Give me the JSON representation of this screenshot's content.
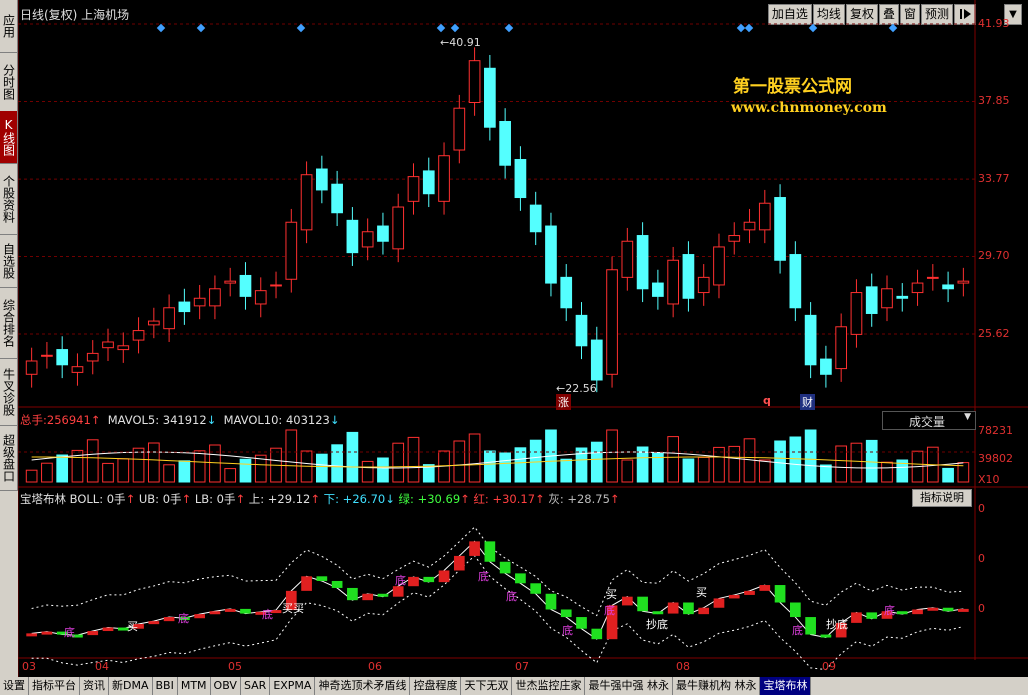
{
  "left_tabs": [
    {
      "label": "应用",
      "active": false
    },
    {
      "label": "分时图",
      "active": false
    },
    {
      "label": "K线图",
      "active": true
    },
    {
      "label": "个股资料",
      "active": false
    },
    {
      "label": "自选股",
      "active": false
    },
    {
      "label": "综合排名",
      "active": false
    },
    {
      "label": "牛叉诊股",
      "active": false
    },
    {
      "label": "超级盘口",
      "active": false
    }
  ],
  "header": {
    "title": "日线(复权) 上海机场"
  },
  "toolbar": {
    "items": [
      "加自选",
      "均线",
      "复权",
      "叠",
      "窗",
      "预测"
    ],
    "end_icon": "play-arrow-icon",
    "dropdown": "▼"
  },
  "watermark": {
    "line1": "第一股票公式网",
    "line2": "www.chnmoney.com"
  },
  "price_axis": [
    "41.93",
    "37.85",
    "33.77",
    "29.70",
    "25.62"
  ],
  "annotations": {
    "high": "40.91",
    "low": "22.56",
    "zhang": "涨",
    "q": "q",
    "cai": "财"
  },
  "volume": {
    "label_total": "总手:",
    "total": "256941",
    "ma5_label": "MAVOL5:",
    "ma5": "341912",
    "ma10_label": "MAVOL10:",
    "ma10": "403123",
    "dropdown": "成交量",
    "axis": [
      "78231",
      "39802",
      "X10"
    ]
  },
  "indicator": {
    "name": "宝塔布林",
    "boll": "BOLL: 0手",
    "ub": "UB: 0手",
    "lb": "LB: 0手",
    "up": "上: +29.12",
    "down": "下: +26.70",
    "green": "绿: +30.69",
    "red": "红: +30.17",
    "gray": "灰: +28.75",
    "help_button": "指标说明",
    "axis": [
      "0",
      "0",
      "0"
    ],
    "labels": [
      {
        "text": "底",
        "color": "#e040e0"
      },
      {
        "text": "买",
        "color": "#ffffff"
      },
      {
        "text": "底",
        "color": "#e040e0"
      },
      {
        "text": "底",
        "color": "#e040e0"
      },
      {
        "text": "买买",
        "color": "#ffffff"
      },
      {
        "text": "底",
        "color": "#e040e0"
      },
      {
        "text": "底",
        "color": "#e040e0"
      },
      {
        "text": "底",
        "color": "#e040e0"
      },
      {
        "text": "底",
        "color": "#e040e0"
      },
      {
        "text": "买",
        "color": "#ffffff"
      },
      {
        "text": "底",
        "color": "#e040e0"
      },
      {
        "text": "抄底",
        "color": "#ffffff"
      },
      {
        "text": "买",
        "color": "#ffffff"
      },
      {
        "text": "底",
        "color": "#e040e0"
      },
      {
        "text": "抄底",
        "color": "#ffffff"
      },
      {
        "text": "底",
        "color": "#e040e0"
      }
    ]
  },
  "months": [
    "03",
    "04",
    "05",
    "06",
    "07",
    "08",
    "09"
  ],
  "bottom_tabs": [
    {
      "label": "设置",
      "active": false
    },
    {
      "label": "指标平台",
      "active": false
    },
    {
      "label": "资讯",
      "active": false
    },
    {
      "label": "新DMA",
      "active": false
    },
    {
      "label": "BBI",
      "active": false
    },
    {
      "label": "MTM",
      "active": false
    },
    {
      "label": "OBV",
      "active": false
    },
    {
      "label": "SAR",
      "active": false
    },
    {
      "label": "EXPMA",
      "active": false
    },
    {
      "label": "神奇选顶术矛盾线",
      "active": false
    },
    {
      "label": "控盘程度",
      "active": false
    },
    {
      "label": "天下无双",
      "active": false
    },
    {
      "label": "世杰监控庄家",
      "active": false
    },
    {
      "label": "最牛强中强 林永",
      "active": false
    },
    {
      "label": "最牛赚机构 林永",
      "active": false
    },
    {
      "label": "宝塔布林",
      "active": true
    }
  ],
  "colors": {
    "up": "#ff3030",
    "down": "#54ffff",
    "axis": "#800000",
    "accent": "#000080"
  },
  "chart_data": {
    "type": "candlestick",
    "title": "日线(复权) 上海机场",
    "x_ticks": [
      "03",
      "04",
      "05",
      "06",
      "07",
      "08",
      "09"
    ],
    "y_ticks": [
      41.93,
      37.85,
      33.77,
      29.7,
      25.62
    ],
    "high": 40.91,
    "low": 22.56,
    "close_approx": [
      24.2,
      24.5,
      24.0,
      23.9,
      24.6,
      25.2,
      25.0,
      25.8,
      26.3,
      27.0,
      26.8,
      27.5,
      28.0,
      28.4,
      27.6,
      27.9,
      28.2,
      31.5,
      34.0,
      33.2,
      32.0,
      29.9,
      31.0,
      30.5,
      32.3,
      33.9,
      33.0,
      35.0,
      37.5,
      40.0,
      36.5,
      34.5,
      32.8,
      31.0,
      28.3,
      27.0,
      25.0,
      23.2,
      29.0,
      30.5,
      28.0,
      27.6,
      29.5,
      27.5,
      28.6,
      30.2,
      30.8,
      31.5,
      32.5,
      29.5,
      27.0,
      24.0,
      23.5,
      26.0,
      27.8,
      26.7,
      28.0,
      27.5,
      28.3,
      28.6,
      28.0,
      28.4
    ]
  }
}
